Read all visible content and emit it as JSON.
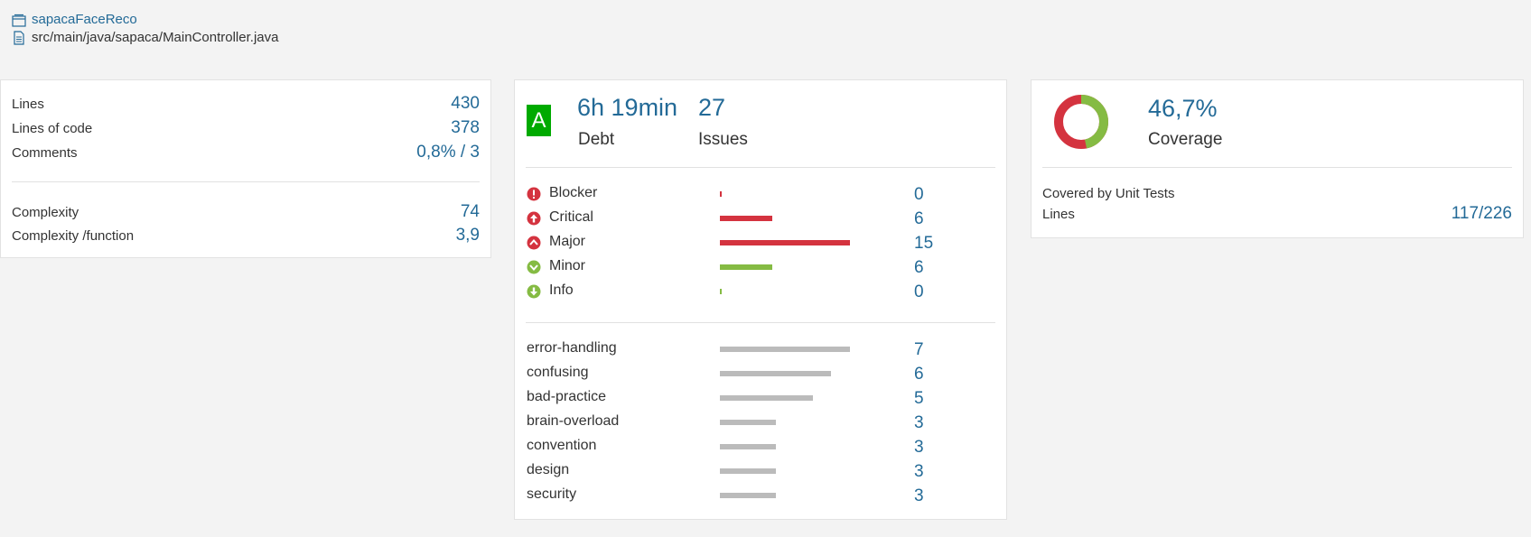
{
  "breadcrumb": {
    "project": "sapacaFaceReco",
    "file": "src/main/java/sapaca/MainController.java"
  },
  "size": {
    "lines_label": "Lines",
    "lines_value": "430",
    "loc_label": "Lines of code",
    "loc_value": "378",
    "comments_label": "Comments",
    "comments_value": "0,8% / 3",
    "complexity_label": "Complexity",
    "complexity_value": "74",
    "complexity_fn_label": "Complexity /function",
    "complexity_fn_value": "3,9"
  },
  "issues": {
    "rating": "A",
    "debt_value": "6h 19min",
    "debt_label": "Debt",
    "issues_value": "27",
    "issues_label": "Issues",
    "severities": [
      {
        "name": "Blocker",
        "count": 0,
        "icon": "blocker-icon",
        "color": "#d4333f"
      },
      {
        "name": "Critical",
        "count": 6,
        "icon": "critical-icon",
        "color": "#d4333f"
      },
      {
        "name": "Major",
        "count": 15,
        "icon": "major-icon",
        "color": "#d4333f"
      },
      {
        "name": "Minor",
        "count": 6,
        "icon": "minor-icon",
        "color": "#85bb43"
      },
      {
        "name": "Info",
        "count": 0,
        "icon": "info-icon",
        "color": "#85bb43"
      }
    ],
    "tags": [
      {
        "name": "error-handling",
        "count": 7
      },
      {
        "name": "confusing",
        "count": 6
      },
      {
        "name": "bad-practice",
        "count": 5
      },
      {
        "name": "brain-overload",
        "count": 3
      },
      {
        "name": "convention",
        "count": 3
      },
      {
        "name": "design",
        "count": 3
      },
      {
        "name": "security",
        "count": 3
      }
    ]
  },
  "coverage": {
    "value": "46,7%",
    "percent": 46.7,
    "label": "Coverage",
    "unit_tests_label": "Covered by Unit Tests",
    "lines_label": "Lines",
    "lines_value": "117/226",
    "covered_color": "#85bb43",
    "uncovered_color": "#d4333f"
  },
  "colors": {
    "link_blue": "#236a97",
    "rating_green": "#00aa00",
    "tag_bar_gray": "#bbbbbb"
  }
}
